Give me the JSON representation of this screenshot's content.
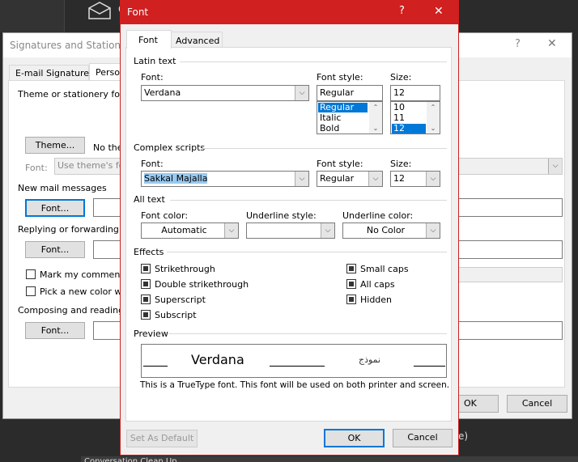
{
  "background": {
    "fragment_c": "C",
    "fragment_e": "e)",
    "bottom_text": "Conversation Clean Up"
  },
  "back_dialog": {
    "title": "Signatures and Stationery",
    "tabs": [
      "E-mail Signature",
      "Personal Stationery"
    ],
    "theme_section": "Theme or stationery for n",
    "theme_button": "Theme...",
    "no_theme": "No theme",
    "font_label": "Font:",
    "font_combo": "Use theme's font",
    "new_mail": "New mail messages",
    "font_button": "Font...",
    "replying": "Replying or forwarding m",
    "mark_comments": "Mark my comments w",
    "pick_color": "Pick a new color whe",
    "composing": "Composing and reading p",
    "ok": "OK",
    "cancel": "Cancel",
    "help": "?",
    "close": "✕"
  },
  "font_dialog": {
    "title": "Font",
    "help": "?",
    "close": "✕",
    "tabs": [
      {
        "label": "Font",
        "active": true
      },
      {
        "label": "Advanced",
        "active": false
      }
    ],
    "latin": {
      "heading": "Latin text",
      "font_label": "Font:",
      "font_value": "Verdana",
      "style_label": "Font style:",
      "style_value": "Regular",
      "style_options": [
        "Regular",
        "Italic",
        "Bold"
      ],
      "style_selected": "Regular",
      "size_label": "Size:",
      "size_value": "12",
      "size_options": [
        "10",
        "11",
        "12"
      ],
      "size_selected": "12"
    },
    "complex": {
      "heading": "Complex scripts",
      "font_label": "Font:",
      "font_value": "Sakkal Majalla",
      "style_label": "Font style:",
      "style_value": "Regular",
      "size_label": "Size:",
      "size_value": "12"
    },
    "all_text": {
      "heading": "All text",
      "color_label": "Font color:",
      "color_value": "Automatic",
      "underline_style_label": "Underline style:",
      "underline_style_value": "",
      "underline_color_label": "Underline color:",
      "underline_color_value": "No Color"
    },
    "effects": {
      "heading": "Effects",
      "left": [
        "Strikethrough",
        "Double strikethrough",
        "Superscript",
        "Subscript"
      ],
      "right": [
        "Small caps",
        "All caps",
        "Hidden"
      ]
    },
    "preview": {
      "heading": "Preview",
      "latin_sample": "Verdana",
      "complex_sample": "نموذج",
      "note": "This is a TrueType font. This font will be used on both printer and screen."
    },
    "buttons": {
      "set_default": "Set As Default",
      "ok": "OK",
      "cancel": "Cancel"
    },
    "accent": "#d02020"
  }
}
